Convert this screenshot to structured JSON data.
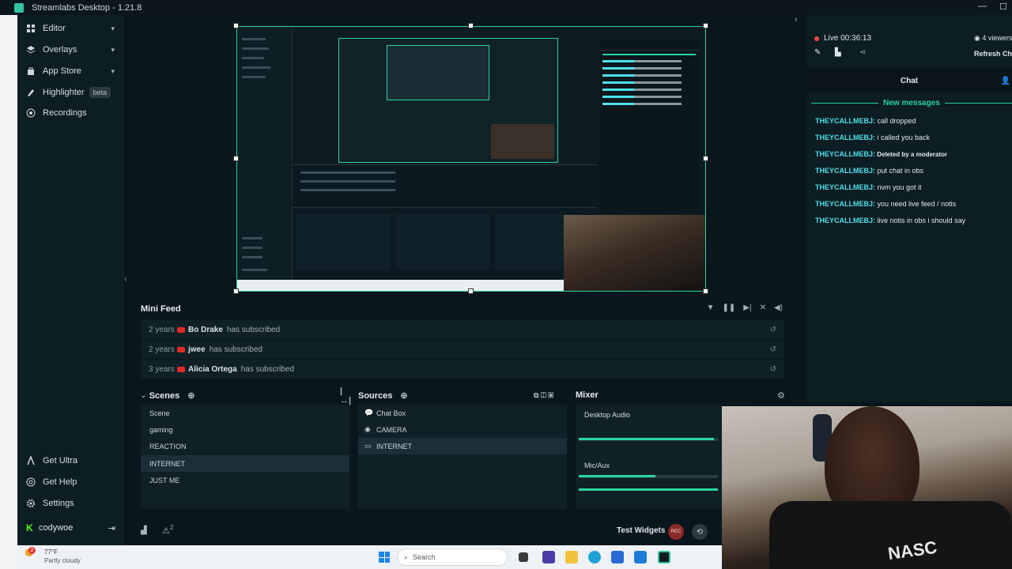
{
  "window": {
    "title": "Streamlabs Desktop - 1.21.8",
    "min": "—",
    "max": "☐"
  },
  "sidebar": {
    "items": [
      {
        "label": "Editor",
        "chev": "▾"
      },
      {
        "label": "Overlays",
        "chev": "▾"
      },
      {
        "label": "App Store",
        "chev": "▾"
      },
      {
        "label": "Highlighter",
        "badge": "beta"
      },
      {
        "label": "Recordings"
      }
    ],
    "bottom": [
      {
        "label": "Get Ultra"
      },
      {
        "label": "Get Help"
      },
      {
        "label": "Settings"
      }
    ],
    "user": {
      "name": "codywoe",
      "logout": "⇥"
    }
  },
  "minifeed": {
    "title": "Mini Feed",
    "rows": [
      {
        "ago": "2 years",
        "name": "Bo Drake",
        "action": "has subscribed"
      },
      {
        "ago": "2 years",
        "name": "jwee",
        "action": "has subscribed"
      },
      {
        "ago": "3 years",
        "name": "Alicia Ortega",
        "action": "has subscribed"
      }
    ]
  },
  "scenes": {
    "title": "Scenes",
    "items": [
      "Scene",
      "gaming",
      "REACTION",
      "INTERNET",
      "JUST ME"
    ],
    "selected": 3
  },
  "sources": {
    "title": "Sources",
    "items": [
      {
        "label": "Chat Box",
        "icon": "💬"
      },
      {
        "label": "CAMERA",
        "icon": "◉"
      },
      {
        "label": "INTERNET",
        "icon": "▭"
      }
    ],
    "selected": 2
  },
  "mixer": {
    "title": "Mixer",
    "channels": [
      {
        "label": "Desktop Audio",
        "level": 0.97
      },
      {
        "label": "Mic/Aux",
        "level": 0.55
      }
    ]
  },
  "footer": {
    "test_widgets": "Test Widgets",
    "rec": "REC",
    "notif_count": "2"
  },
  "chat": {
    "live": "Live 00:36:13",
    "viewers": "4 viewers",
    "refresh": "Refresh Chat",
    "tab": "Chat",
    "new_messages": "New messages",
    "messages": [
      {
        "user": "THEYCALLMEBJ:",
        "text": "call dropped"
      },
      {
        "user": "THEYCALLMEBJ:",
        "text": "i called you back"
      },
      {
        "user": "THEYCALLMEBJ:",
        "text": "Deleted by a moderator"
      },
      {
        "user": "THEYCALLMEBJ:",
        "text": "put chat in obs"
      },
      {
        "user": "THEYCALLMEBJ:",
        "text": "nvm you got it"
      },
      {
        "user": "THEYCALLMEBJ:",
        "text": "you need live feed / notis"
      },
      {
        "user": "THEYCALLMEBJ:",
        "text": "live notis in obs i should say"
      }
    ]
  },
  "taskbar": {
    "temp": "77°F",
    "weather": "Partly cloudy",
    "search": "Search",
    "badge": "2"
  },
  "webcam": {
    "shirt_text": "NASC"
  },
  "colors": {
    "accent": "#2bd49f",
    "chat_user": "#4fe0e8",
    "live": "#f04747",
    "bg": "#09161d"
  }
}
